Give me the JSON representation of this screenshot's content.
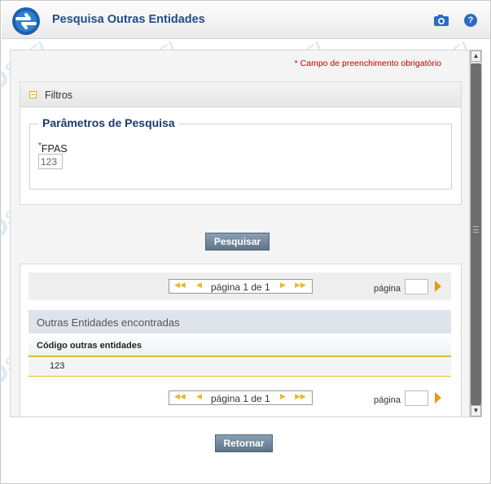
{
  "title_bar": {
    "title": "Pesquisa Outras Entidades",
    "help_label": "?"
  },
  "form": {
    "required_note": "* Campo de preenchimento obrigatório",
    "filters_label": "Filtros",
    "parameters_legend": "Parâmetros de Pesquisa",
    "fpas": {
      "required_mark": "*",
      "label": "FPAS",
      "value": "123"
    },
    "search_button": "Pesquisar"
  },
  "results": {
    "pager_top": {
      "first": "◀◀",
      "prev": "◀",
      "text": "página 1 de 1",
      "next": "▶",
      "last": "▶▶",
      "page_label": "página",
      "page_value": ""
    },
    "table_caption": "Outras Entidades encontradas",
    "columns": [
      "Código outras entidades"
    ],
    "rows": [
      [
        "123"
      ]
    ],
    "pager_bottom": {
      "first": "◀◀",
      "prev": "◀",
      "text": "página 1 de 1",
      "next": "▶",
      "last": "▶▶",
      "page_label": "página",
      "page_value": ""
    }
  },
  "footer": {
    "return_button": "Retornar"
  },
  "watermark": {
    "text": "SIAFI"
  },
  "colors": {
    "title": "#1f4e8c",
    "accent": "#e8b930",
    "required": "#c00000",
    "button": "#6c8297"
  }
}
